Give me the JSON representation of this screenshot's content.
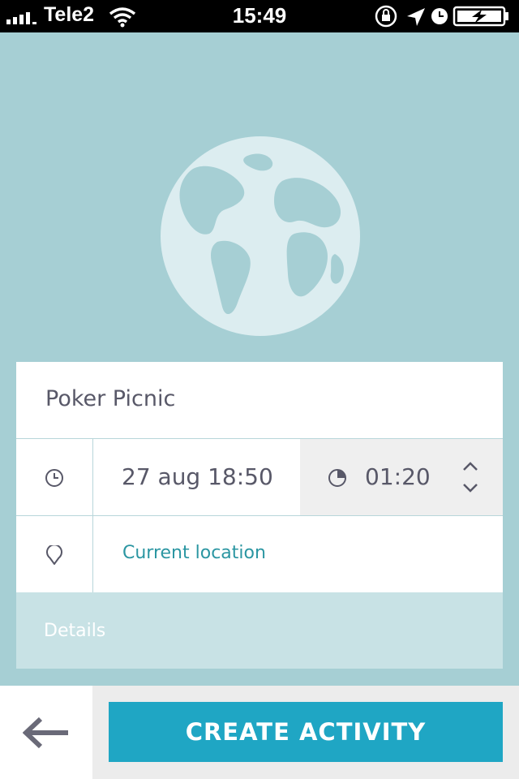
{
  "status_bar": {
    "carrier": "Tele2",
    "time": "15:49",
    "icons": [
      "signal-icon",
      "wifi-icon",
      "rotation-lock-icon",
      "location-arrow-icon",
      "alarm-clock-icon",
      "battery-charging-icon"
    ]
  },
  "hero": {
    "icon": "globe-icon"
  },
  "form": {
    "title": "Poker Picnic",
    "datetime": "27 aug 18:50",
    "duration": "01:20",
    "location": "Current location",
    "details_placeholder": "Details",
    "icons": {
      "datetime": "clock-icon",
      "duration": "pie-timer-icon",
      "stepper": "up-down-chevron-icon",
      "location": "map-pin-icon"
    }
  },
  "actions": {
    "back_icon": "arrow-left-icon",
    "create_label": "CREATE ACTIVITY"
  },
  "colors": {
    "background": "#a6cfd4",
    "accent": "#1fa6c4",
    "link": "#2b96a2",
    "text": "#585868"
  }
}
